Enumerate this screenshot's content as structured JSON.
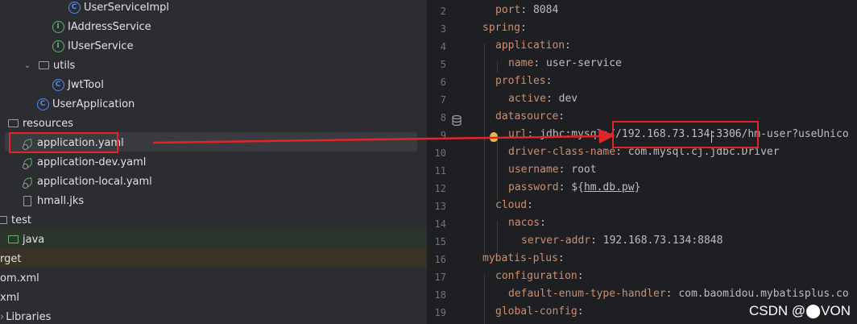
{
  "project_tree": {
    "items": [
      {
        "label": "UserServiceImpl",
        "icon": "class-icon"
      },
      {
        "label": "IAddressService",
        "icon": "interface-icon"
      },
      {
        "label": "IUserService",
        "icon": "interface-icon"
      },
      {
        "label": "utils",
        "icon": "folder-icon"
      },
      {
        "label": "JwtTool",
        "icon": "class-icon"
      },
      {
        "label": "UserApplication",
        "icon": "spring-class-icon"
      },
      {
        "label": "resources",
        "icon": "folder-icon"
      },
      {
        "label": "application.yaml",
        "icon": "spring-config-icon",
        "selected": true
      },
      {
        "label": "application-dev.yaml",
        "icon": "spring-config-icon"
      },
      {
        "label": "application-local.yaml",
        "icon": "spring-config-icon"
      },
      {
        "label": "hmall.jks",
        "icon": "file-icon"
      },
      {
        "label": "test",
        "icon": "folder-icon"
      },
      {
        "label": "java",
        "icon": "folder-icon"
      },
      {
        "label": "rget",
        "icon": "none"
      },
      {
        "label": "om.xml",
        "icon": "none"
      },
      {
        "label": "xml",
        "icon": "none"
      },
      {
        "label": "Libraries",
        "icon": "none"
      }
    ]
  },
  "editor": {
    "line_numbers": [
      "2",
      "3",
      "4",
      "5",
      "6",
      "7",
      "8",
      "9",
      "10",
      "11",
      "12",
      "13",
      "14",
      "15",
      "16",
      "17",
      "18",
      "19"
    ],
    "lines": [
      {
        "key": "port",
        "sep": ": ",
        "value": "8084"
      },
      {
        "key": "spring",
        "sep": ":",
        "value": ""
      },
      {
        "key": "application",
        "sep": ":",
        "value": ""
      },
      {
        "key": "name",
        "sep": ": ",
        "value": "user-service"
      },
      {
        "key": "profiles",
        "sep": ":",
        "value": ""
      },
      {
        "key": "active",
        "sep": ": ",
        "value": "dev"
      },
      {
        "key": "datasource",
        "sep": ":",
        "value": ""
      },
      {
        "key": "url",
        "sep": ": ",
        "value": "jdbc:mysql://192.168.73.134:3306/hm-user?useUnico"
      },
      {
        "key": "driver-class-name",
        "sep": ": ",
        "value": "com.mysql.cj.jdbc.Driver"
      },
      {
        "key": "username",
        "sep": ": ",
        "value": "root"
      },
      {
        "key": "password",
        "sep": ": ",
        "value_prefix": "${",
        "value_link": "hm.db.pw",
        "value_suffix": "}"
      },
      {
        "key": "cloud",
        "sep": ":",
        "value": ""
      },
      {
        "key": "nacos",
        "sep": ":",
        "value": ""
      },
      {
        "key": "server-addr",
        "sep": ": ",
        "value": "192.168.73.134:8848"
      },
      {
        "key": "mybatis-plus",
        "sep": ":",
        "value": ""
      },
      {
        "key": "configuration",
        "sep": ":",
        "value": ""
      },
      {
        "key": "default-enum-type-handler",
        "sep": ": ",
        "value": "com.baomidou.mybatisplus.co"
      },
      {
        "key": "global-config",
        "sep": ":",
        "value": ""
      }
    ],
    "line9_visible": {
      "start": "ur",
      "middle": "//192.168.73.134:3306/hm-user?useUnico"
    }
  },
  "watermark": "CSDN @⬤VON",
  "colors": {
    "key": "#cf8e6d",
    "annotation": "#e0252b",
    "tree_bg": "#2b2d30",
    "editor_bg": "#1e1f22"
  }
}
